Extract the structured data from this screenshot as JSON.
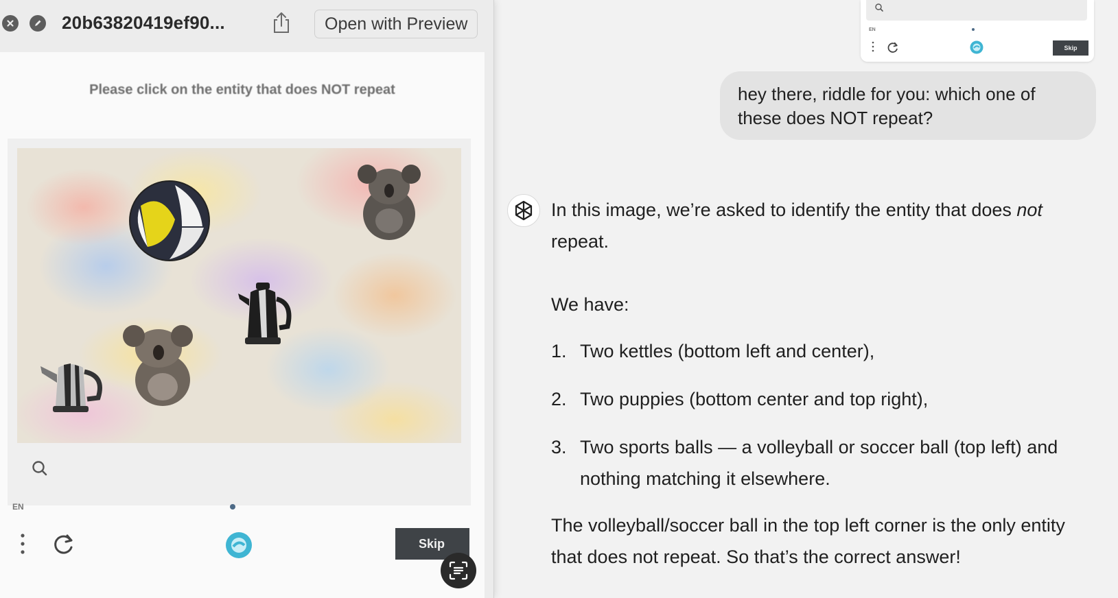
{
  "window": {
    "title": "20b63820419ef90...",
    "open_button_label": "Open with Preview"
  },
  "captcha": {
    "instruction": "Please click on the entity that does NOT repeat",
    "language": "EN",
    "skip_label": "Skip",
    "thumb_language": "EN",
    "thumb_skip_label": "Skip",
    "logo_color": "#3fb5d3"
  },
  "chat": {
    "user_message": "hey there, riddle for you: which one of these does NOT repeat?",
    "assistant": {
      "intro_part1": "In this image, we’re asked to identify the entity that does ",
      "intro_em": "not",
      "intro_part2": " repeat.",
      "we_have": "We have:",
      "list": [
        {
          "num": "1.",
          "text": "Two kettles (bottom left and center),"
        },
        {
          "num": "2.",
          "text": "Two puppies (bottom center and top right),"
        },
        {
          "num": "3.",
          "text": "Two sports balls — a volleyball or soccer ball (top left) and nothing matching it elsewhere."
        }
      ],
      "conclusion": "The volleyball/soccer ball in the top left corner is the only entity that does not repeat. So that’s the correct answer!"
    }
  }
}
